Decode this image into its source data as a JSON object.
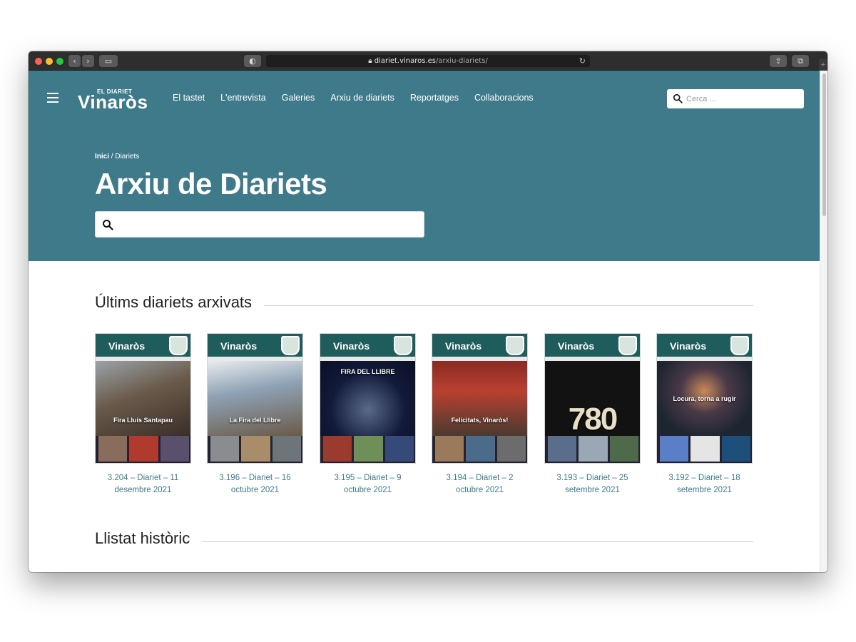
{
  "browser": {
    "url_host": "diariet.vinaros.es",
    "url_path": "/arxiu-diariets/"
  },
  "header": {
    "logo_small": "EL DIARIET",
    "logo_big": "Vinaròs",
    "nav": [
      "El tastet",
      "L'entrevista",
      "Galeries",
      "Arxiu de diariets",
      "Reportatges",
      "Collaboracions"
    ],
    "search_placeholder": "Cerca ..."
  },
  "hero": {
    "breadcrumb_home": "Inici",
    "breadcrumb_sep": " / ",
    "breadcrumb_current": "Diariets",
    "title": "Arxiu de Diariets",
    "search_value": ""
  },
  "sections": {
    "latest_title": "Últims diariets arxivats",
    "history_title": "Llistat històric"
  },
  "covers": [
    {
      "caption": "3.204 – Diariet – 11 desembre 2021",
      "headline": "Fira Lluís Santapau",
      "photo_color": "#6a5a4a",
      "thumb_colors": [
        "#8a6c5c",
        "#b03a2e",
        "#5a4f6d"
      ]
    },
    {
      "caption": "3.196 – Diariet – 16 octubre 2021",
      "headline": "La Fira del Llibre",
      "photo_color": "#8fa2b5",
      "thumb_colors": [
        "#8a8d8f",
        "#a98d6a",
        "#6d747a"
      ]
    },
    {
      "caption": "3.195 – Diariet – 9 octubre 2021",
      "headline": "FIRA DEL LLIBRE",
      "photo_color": "#121a3a",
      "thumb_colors": [
        "#9b3a2f",
        "#6f8f58",
        "#354a78"
      ]
    },
    {
      "caption": "3.194 – Diariet – 2 octubre 2021",
      "headline": "Felicitats, Vinaròs!",
      "photo_color": "#8a2a24",
      "thumb_colors": [
        "#9a7a5a",
        "#4a6b8a",
        "#6c6c6c"
      ]
    },
    {
      "caption": "3.193 – Diariet – 25 setembre 2021",
      "headline": "780",
      "photo_color": "#121212",
      "thumb_colors": [
        "#5a6d8a",
        "#9aa7b5",
        "#4e6a4a"
      ]
    },
    {
      "caption": "3.192 – Diariet – 18 setembre 2021",
      "headline": "Locura, torna a rugir",
      "photo_color": "#1c2530",
      "thumb_colors": [
        "#5b7ec9",
        "#e5e5e5",
        "#1e4f7a"
      ]
    }
  ]
}
